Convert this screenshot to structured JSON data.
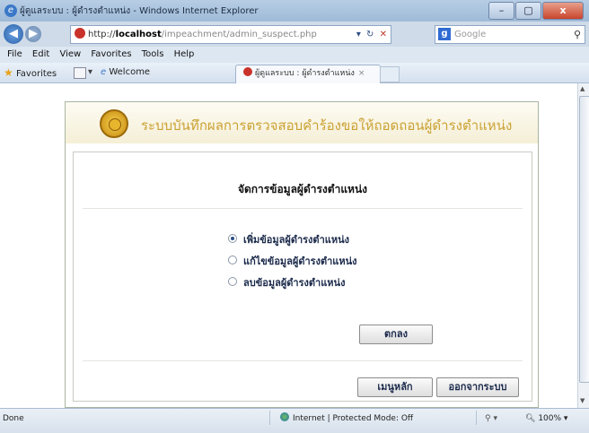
{
  "window": {
    "title": "ผู้ดูแลระบบ : ผู้ดำรงตำแหน่ง - Windows Internet Explorer",
    "min_glyph": "–",
    "max_glyph": "▢",
    "close_glyph": "x"
  },
  "toolbar": {
    "back_glyph": "◀",
    "forward_glyph": "▶",
    "address_prefix": "http://",
    "address_host": "localhost",
    "address_path": "/impeachment/admin_suspect.php",
    "refresh_glyph": "↻",
    "stop_glyph": "✕",
    "search_placeholder": "Google",
    "search_glyph": "⚲"
  },
  "menu": [
    "File",
    "Edit",
    "View",
    "Favorites",
    "Tools",
    "Help"
  ],
  "favorites_bar": {
    "favorites_label": "Favorites",
    "welcome_label": "Welcome",
    "tab_title": "ผู้ดูแลระบบ : ผู้ดำรงตำแหน่ง",
    "tab_close": "×"
  },
  "page": {
    "header_title": "ระบบบันทึกผลการตรวจสอบคำร้องขอให้ถอดถอนผู้ดำรงตำแหน่ง",
    "section_title": "จัดการข้อมูลผู้ดำรงตำแหน่ง",
    "options": [
      {
        "label": "เพิ่มข้อมูลผู้ดำรงตำแหน่ง",
        "selected": true
      },
      {
        "label": "แก้ไขข้อมูลผู้ดำรงตำแหน่ง",
        "selected": false
      },
      {
        "label": "ลบข้อมูลผู้ดำรงตำแหน่ง",
        "selected": false
      }
    ],
    "ok_button": "ตกลง",
    "main_menu_button": "เมนูหลัก",
    "logout_button": "ออกจากระบบ"
  },
  "statusbar": {
    "status": "Done",
    "zone": "Internet | Protected Mode: Off",
    "security_glyph": "⚲ ▾",
    "zoom": "100%"
  }
}
